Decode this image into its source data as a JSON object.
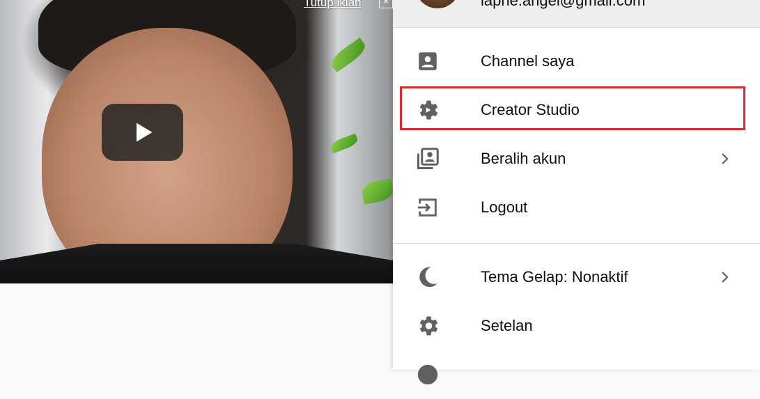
{
  "video": {
    "close_ad_label": "Tutup iklan",
    "close_ad_x": "×",
    "play_icon": "play-icon"
  },
  "account": {
    "email": "laphe.angel@gmail.com"
  },
  "menu": {
    "items": [
      {
        "label": "Channel saya",
        "icon": "account-box-icon",
        "chevron": false
      },
      {
        "label": "Creator Studio",
        "icon": "gear-icon",
        "chevron": false
      },
      {
        "label": "Beralih akun",
        "icon": "switch-account-icon",
        "chevron": true
      },
      {
        "label": "Logout",
        "icon": "logout-icon",
        "chevron": false
      },
      {
        "label": "Tema Gelap: Nonaktif",
        "icon": "moon-icon",
        "chevron": true
      },
      {
        "label": "Setelan",
        "icon": "gear-icon",
        "chevron": false
      }
    ]
  },
  "colors": {
    "highlight": "#d9282f",
    "icon": "#606060",
    "text": "#0f0f0f"
  }
}
